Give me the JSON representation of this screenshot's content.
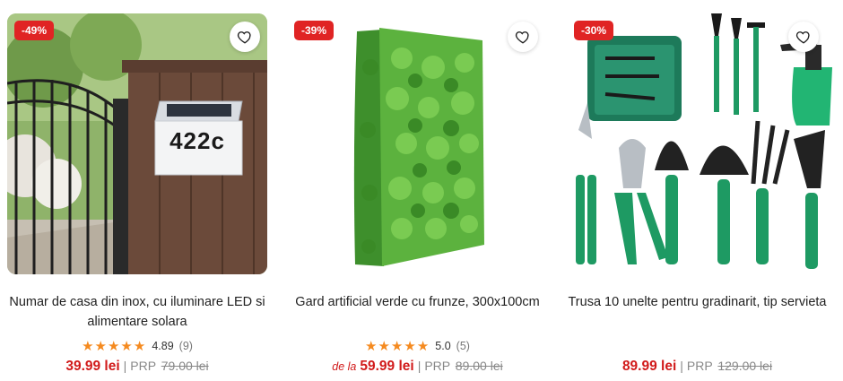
{
  "products": [
    {
      "discount": "-49%",
      "title_line1": "Numar de casa din inox, cu iluminare LED si",
      "title_line2": "alimentare solara",
      "stars": "★★★★★",
      "rating_value": "4.89",
      "rating_count": "(9)",
      "price_prefix": "",
      "price": "39.99 lei",
      "separator": "|",
      "prp_label": "PRP",
      "old_price": "79.00 lei",
      "house_number": "422c",
      "icon": "heart-icon"
    },
    {
      "discount": "-39%",
      "title_line1": "Gard artificial verde cu frunze, 300x100cm",
      "stars": "★★★★★",
      "rating_value": "5.0",
      "rating_count": "(5)",
      "price_prefix": "de la",
      "price": "59.99 lei",
      "separator": "|",
      "prp_label": "PRP",
      "old_price": "89.00 lei",
      "icon": "heart-icon"
    },
    {
      "discount": "-30%",
      "title_line1": "Trusa 10 unelte pentru gradinarit, tip servieta",
      "price": "89.99 lei",
      "separator": "|",
      "prp_label": "PRP",
      "old_price": "129.00 lei",
      "icon": "heart-icon"
    }
  ],
  "colors": {
    "discount_badge": "#e02424",
    "price": "#d11a1a",
    "star": "#f58a1f"
  }
}
